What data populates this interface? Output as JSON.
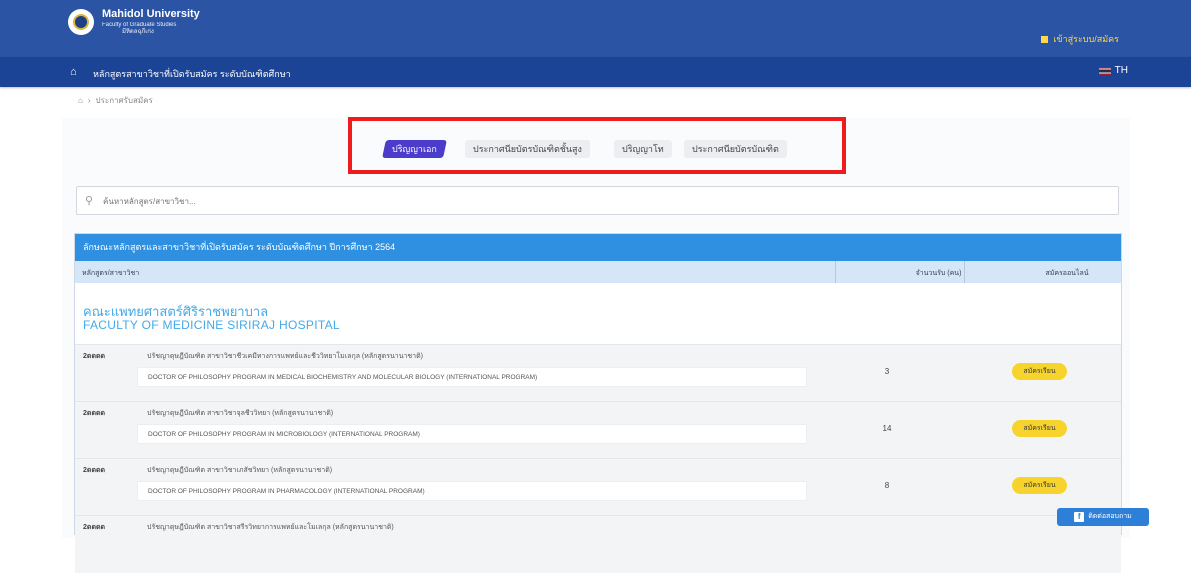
{
  "header": {
    "logo_title": "Mahidol University",
    "logo_sub": "Faculty of Graduate Studies",
    "logo_sub2": "มีหิดลฉุกีเก่ง",
    "user_link": "เข้าสู่ระบบ/สมัคร"
  },
  "nav": {
    "title": "หลักสูตรสาขาวิชาที่เปิดรับสมัคร ระดับบัณฑิตศึกษา",
    "lang": "TH"
  },
  "breadcrumb": {
    "current": "ประกาศรับสมัคร"
  },
  "tabs": [
    {
      "label": "ปริญญาเอก",
      "active": true
    },
    {
      "label": "ประกาศนียบัตรบัณฑิตชั้นสูง",
      "active": false
    },
    {
      "label": "ปริญญาโท",
      "active": false
    },
    {
      "label": "ประกาศนียบัตรบัณฑิต",
      "active": false
    }
  ],
  "search": {
    "placeholder": "ค้นหาหลักสูตร/สาขาวิชา..."
  },
  "table": {
    "title": "ลักษณะหลักสูตรและสาขาวิชาที่เปิดรับสมัคร ระดับบัณฑิตศึกษา ปีการศึกษา 2564",
    "headers": {
      "name": "หลักสูตร/สาขาวิชา",
      "count": "จำนวนรับ (คน)",
      "apply": "สมัครออนไลน์"
    },
    "faculty": {
      "name_th": "คณะแพทยศาสตร์ศิริราชพยาบาล",
      "name_en": "FACULTY OF MEDICINE SIRIRAJ HOSPITAL"
    },
    "rows": [
      {
        "code": "2ดดดด",
        "name_th": "ปรัชญาดุษฎีบัณฑิต สาขาวิชาชีวเคมีทางการแพทย์และชีววิทยาโมเลกุล (หลักสูตรนานาชาติ)",
        "name_en": "DOCTOR OF PHILOSOPHY PROGRAM IN MEDICAL BIOCHEMISTRY AND MOLECULAR BIOLOGY (INTERNATIONAL PROGRAM)",
        "count": "3",
        "apply_label": "สมัครเรียน"
      },
      {
        "code": "2ดดดด",
        "name_th": "ปรัชญาดุษฎีบัณฑิต สาขาวิชาจุลชีววิทยา (หลักสูตรนานาชาติ)",
        "name_en": "DOCTOR OF PHILOSOPHY PROGRAM IN MICROBIOLOGY (INTERNATIONAL PROGRAM)",
        "count": "14",
        "apply_label": "สมัครเรียน"
      },
      {
        "code": "2ดดดด",
        "name_th": "ปรัชญาดุษฎีบัณฑิต สาขาวิชาเภสัชวิทยา (หลักสูตรนานาชาติ)",
        "name_en": "DOCTOR OF PHILOSOPHY PROGRAM IN PHARMACOLOGY (INTERNATIONAL PROGRAM)",
        "count": "8",
        "apply_label": "สมัครเรียน"
      },
      {
        "code": "2ดดดด",
        "name_th": "ปรัชญาดุษฎีบัณฑิต สาขาวิชาสรีรวิทยาการแพทย์และโมเลกุล (หลักสูตรนานาชาติ)",
        "name_en": "",
        "count": "",
        "apply_label": ""
      }
    ]
  },
  "chat_button": "ติดต่อสอบถาม"
}
